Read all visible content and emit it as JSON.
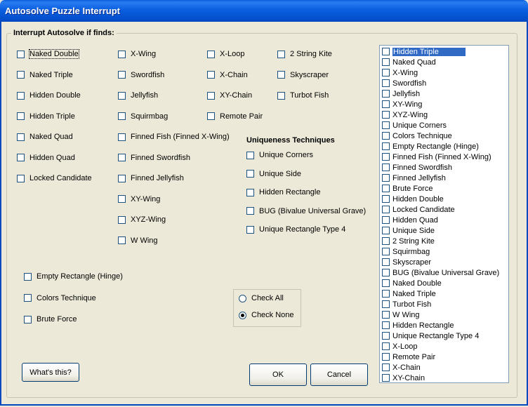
{
  "window": {
    "title": "Autosolve Puzzle Interrupt"
  },
  "group": {
    "label": "Interrupt Autosolve if finds:"
  },
  "col1": [
    "Naked Double",
    "Naked Triple",
    "Hidden Double",
    "Hidden Triple",
    "Naked Quad",
    "Hidden Quad",
    "Locked Candidate"
  ],
  "col2": [
    "X-Wing",
    "Swordfish",
    "Jellyfish",
    "Squirmbag",
    "Finned Fish (Finned X-Wing)",
    "Finned Swordfish",
    "Finned Jellyfish",
    "XY-Wing",
    "XYZ-Wing",
    "W Wing"
  ],
  "col3": [
    "X-Loop",
    "X-Chain",
    "XY-Chain",
    "Remote Pair"
  ],
  "col4": [
    "2 String Kite",
    "Skyscraper",
    "Turbot Fish"
  ],
  "uniqueness": {
    "title": "Uniqueness Techniques",
    "items": [
      "Unique Corners",
      "Unique Side",
      "Hidden Rectangle",
      "BUG (Bivalue Universal Grave)",
      "Unique Rectangle Type 4"
    ]
  },
  "extra": [
    "Empty Rectangle (Hinge)",
    "Colors Technique",
    "Brute Force"
  ],
  "radio": {
    "check_all": "Check All",
    "check_none": "Check None",
    "selected": "check_none"
  },
  "buttons": {
    "whats_this": "What's this?",
    "ok": "OK",
    "cancel": "Cancel"
  },
  "list": {
    "selected_index": 0,
    "items": [
      "Hidden Triple",
      "Naked Quad",
      "X-Wing",
      "Swordfish",
      "Jellyfish",
      "XY-Wing",
      "XYZ-Wing",
      "Unique Corners",
      "Colors Technique",
      "Empty Rectangle (Hinge)",
      "Finned Fish (Finned X-Wing)",
      "Finned Swordfish",
      "Finned Jellyfish",
      "Brute Force",
      "Hidden Double",
      "Locked Candidate",
      "Hidden Quad",
      "Unique Side",
      "2 String Kite",
      "Squirmbag",
      "Skyscraper",
      "BUG (Bivalue Universal Grave)",
      "Naked Double",
      "Naked Triple",
      "Turbot Fish",
      "W Wing",
      "Hidden Rectangle",
      "Unique Rectangle Type 4",
      "X-Loop",
      "Remote Pair",
      "X-Chain",
      "XY-Chain"
    ]
  }
}
